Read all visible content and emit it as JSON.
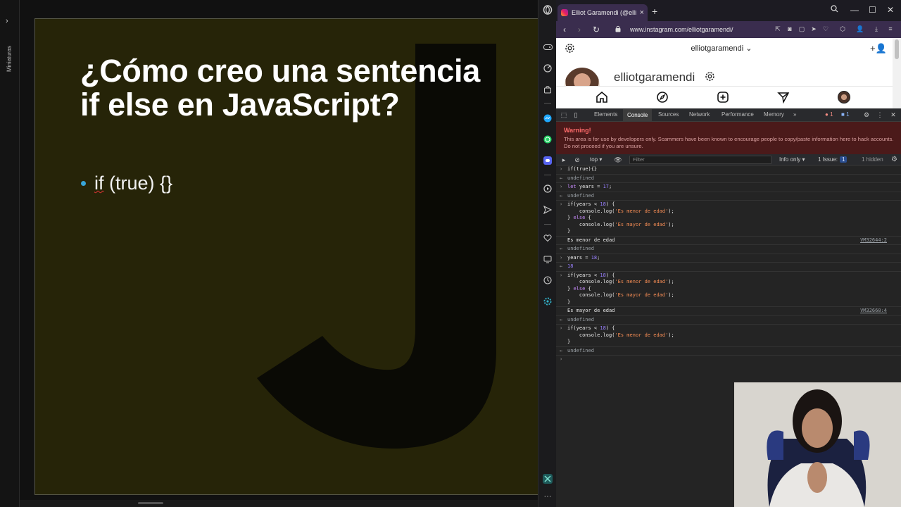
{
  "slide_app": {
    "thumbnails_label": "Miniaturas",
    "slide": {
      "title_line1": "¿Cómo creo una sentencia",
      "title_line2": "if else en JavaScript?",
      "bullet_kw": "if",
      "bullet_rest": " (true) {}"
    }
  },
  "browser": {
    "tab_title": "Elliot Garamendi (@elliotg…",
    "url": "www.instagram.com/elliotgaramendi/",
    "instagram": {
      "username": "elliotgaramendi",
      "profile_name": "elliotgaramendi"
    },
    "devtools": {
      "tabs": [
        "Elements",
        "Console",
        "Sources",
        "Network",
        "Performance",
        "Memory"
      ],
      "error_count": "1",
      "message_count": "1",
      "warning_title": "Warning!",
      "warning_text": "This area is for use by developers only. Scammers have been known to encourage people to copy/paste information here to hack accounts. Do not proceed if you are unsure.",
      "context": "top",
      "filter_placeholder": "Filter",
      "levels": "Info only",
      "issues_label": "1 Issue:",
      "issues_count": "1",
      "hidden": "1 hidden",
      "console_lines": [
        {
          "type": "input",
          "text": "if(true){}"
        },
        {
          "type": "result",
          "text": "undefined"
        },
        {
          "type": "input",
          "text": "let years = 17;"
        },
        {
          "type": "result",
          "text": "undefined"
        },
        {
          "type": "input",
          "text": "if(years < 18) {\n    console.log('Es menor de edad');\n} else {\n    console.log('Es mayor de edad');\n}"
        },
        {
          "type": "log",
          "text": "Es menor de edad",
          "source": "VM32644:2"
        },
        {
          "type": "result",
          "text": "undefined"
        },
        {
          "type": "input",
          "text": "years = 18;"
        },
        {
          "type": "result",
          "text": "18"
        },
        {
          "type": "input",
          "text": "if(years < 18) {\n    console.log('Es menor de edad');\n} else {\n    console.log('Es mayor de edad');\n}"
        },
        {
          "type": "log",
          "text": "Es mayor de edad",
          "source": "VM32660:4"
        },
        {
          "type": "result",
          "text": "undefined"
        },
        {
          "type": "input",
          "text": "if(years < 18) {\n    console.log('Es menor de edad');\n}"
        },
        {
          "type": "result",
          "text": "undefined"
        },
        {
          "type": "prompt",
          "text": ""
        }
      ]
    }
  },
  "colors": {
    "slide_bg": "#262408",
    "bullet": "#38a5d8",
    "tab_active": "#3a2d4e",
    "warning_bg": "#4b1a1a",
    "warning_title": "#ff6b6b"
  },
  "icons": {
    "sidebar": [
      "opera-logo-icon",
      "gamepad-icon",
      "speed-dial-icon",
      "shopping-bag-icon",
      "messenger-icon",
      "whatsapp-icon",
      "discord-icon",
      "player-icon",
      "send-icon",
      "heart-icon",
      "monitor-icon",
      "history-icon",
      "settings-icon",
      "extension-icon",
      "more-icon"
    ]
  }
}
